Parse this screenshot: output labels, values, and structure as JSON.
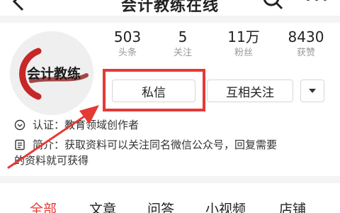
{
  "header": {
    "title": "会计教练在线"
  },
  "avatar": {
    "text": "会计教练"
  },
  "stats": [
    {
      "value": "503",
      "label": "头条"
    },
    {
      "value": "5",
      "label": "关注"
    },
    {
      "value": "11万",
      "label": "粉丝"
    },
    {
      "value": "8430",
      "label": "获赞"
    }
  ],
  "actions": {
    "message_label": "私信",
    "follow_label": "互相关注"
  },
  "profile": {
    "verify_label": "认证：",
    "verify_text": "教育领域创作者",
    "intro_label": "简介：",
    "intro_line1": "获取资料可以关注同名微信公众号，回复需要",
    "intro_line2": "的资料就可获得"
  },
  "tabs": [
    {
      "label": "全部",
      "active": true
    },
    {
      "label": "文章"
    },
    {
      "label": "问答"
    },
    {
      "label": "小视频"
    },
    {
      "label": "店铺"
    }
  ],
  "colors": {
    "accent": "#e53935",
    "annotation": "#e53935",
    "muted": "#999999"
  },
  "icons": [
    "back-arrow-icon",
    "search-icon",
    "more-dots-icon",
    "verified-icon",
    "document-icon",
    "chevron-down-icon"
  ]
}
